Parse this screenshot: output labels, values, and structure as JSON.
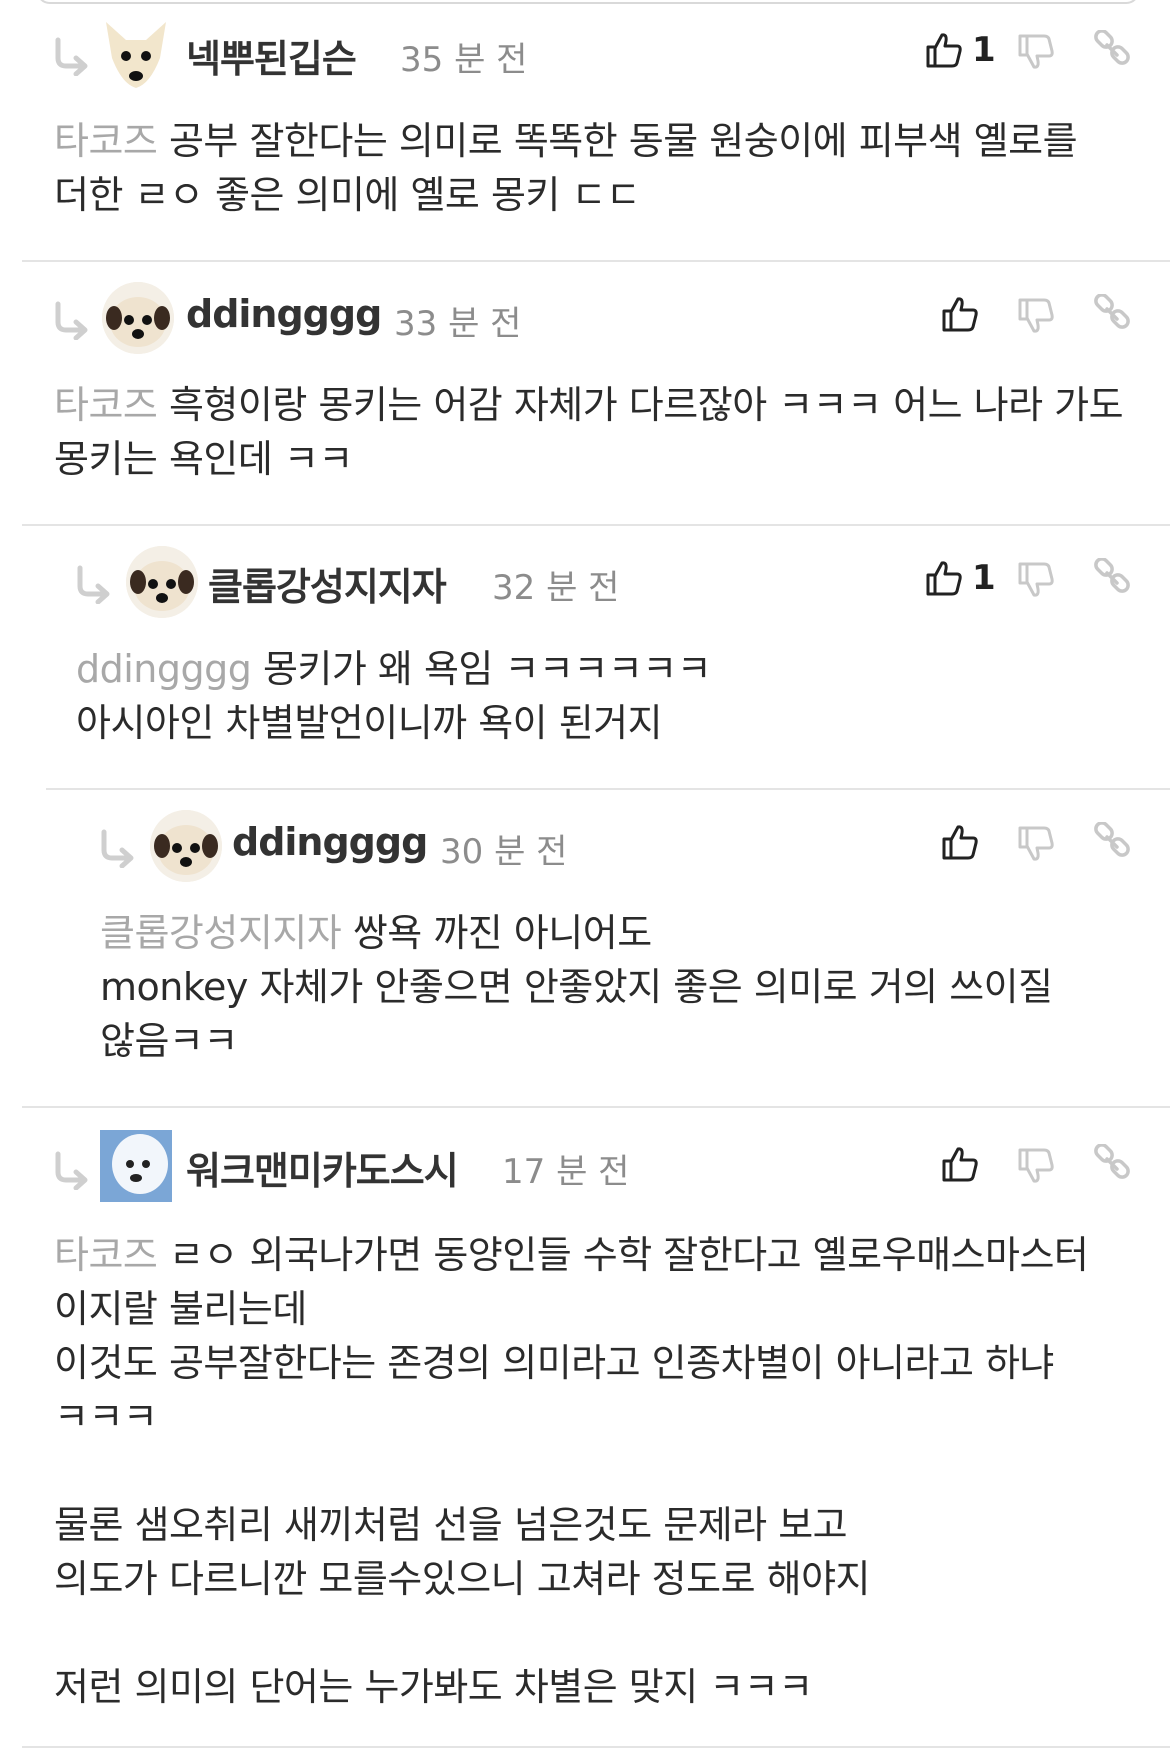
{
  "comments": [
    {
      "nickname": "넥뿌된깁슨",
      "time": "35 분 전",
      "likes": "1",
      "mention": "타코즈",
      "text": " 공부 잘한다는 의미로 똑똑한 동물 원숭이에 피부색 옐로를 더한 ㄹㅇ 좋은 의미에 옐로 몽키 ㄷㄷ"
    },
    {
      "nickname": "ddingggg",
      "time": "33 분 전",
      "likes": "",
      "mention": "타코즈",
      "text": " 흑형이랑 몽키는 어감 자체가 다르잖아 ㅋㅋㅋ 어느 나라 가도 몽키는 욕인데 ㅋㅋ"
    },
    {
      "nickname": "클롭강성지지자",
      "time": "32 분 전",
      "likes": "1",
      "mention": "ddingggg",
      "text": " 몽키가 왜 욕임 ㅋㅋㅋㅋㅋㅋ\n아시아인 차별발언이니까 욕이 된거지"
    },
    {
      "nickname": "ddingggg",
      "time": "30 분 전",
      "likes": "",
      "mention": "클롭강성지지자",
      "text": " 쌍욕 까진 아니어도\nmonkey 자체가 안좋으면 안좋았지 좋은 의미로 거의 쓰이질 않음ㅋㅋ"
    },
    {
      "nickname": "워크맨미카도스시",
      "time": "17 분 전",
      "likes": "",
      "mention": "타코즈",
      "text": " ㄹㅇ 외국나가면 동양인들 수학 잘한다고 옐로우매스마스터 이지랄 불리는데\n이것도 공부잘한다는 존경의 의미라고 인종차별이 아니라고 하냐 ㅋㅋㅋ",
      "paragraph2": "물론 샘오취리 새끼처럼 선을 넘은것도 문제라 보고\n의도가 다르니깐 모를수있으니 고쳐라 정도로 해야지",
      "paragraph3": "저런 의미의 단어는 누가봐도 차별은 맞지 ㅋㅋㅋ"
    }
  ],
  "icons": {
    "reply": "reply-arrow-icon",
    "like": "thumbs-up-icon",
    "dislike": "thumbs-down-icon",
    "link": "link-icon"
  },
  "colors": {
    "mention": "#a8a8a8",
    "time": "#8c8c8c",
    "divider": "#e4e4e4",
    "icon_gray": "#c8c8c8"
  }
}
